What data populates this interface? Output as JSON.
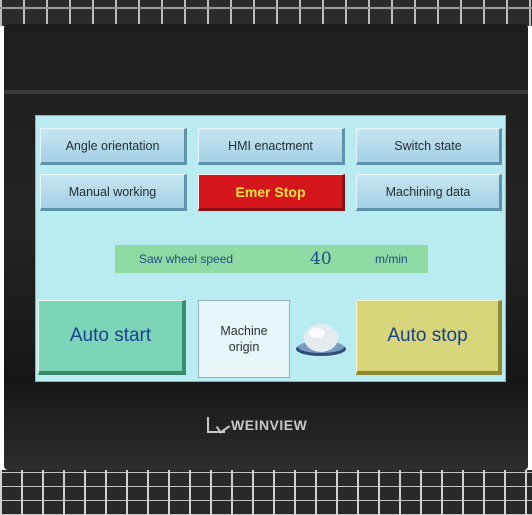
{
  "hmi": {
    "top_buttons": [
      {
        "label": "Angle orientation"
      },
      {
        "label": "HMI enactment"
      },
      {
        "label": "Switch state"
      }
    ],
    "second_row_buttons": [
      {
        "label": "Manual working"
      },
      {
        "label": "Emer Stop"
      },
      {
        "label": "Machining data"
      }
    ],
    "speed": {
      "label": "Saw wheel speed",
      "value": "40",
      "unit": "m/min"
    },
    "bottom": {
      "auto_start_label": "Auto start",
      "machine_origin_line1": "Machine",
      "machine_origin_line2": "origin",
      "auto_stop_label": "Auto stop"
    },
    "colors": {
      "screen_bg": "#b8ecf0",
      "emer_bg": "#d4161c",
      "emer_text": "#ffe23a",
      "speed_bar": "#90dba4",
      "auto_start": "#7cd5b7",
      "auto_stop": "#d8d67a"
    }
  },
  "device": {
    "brand": "WEINVIEW"
  }
}
